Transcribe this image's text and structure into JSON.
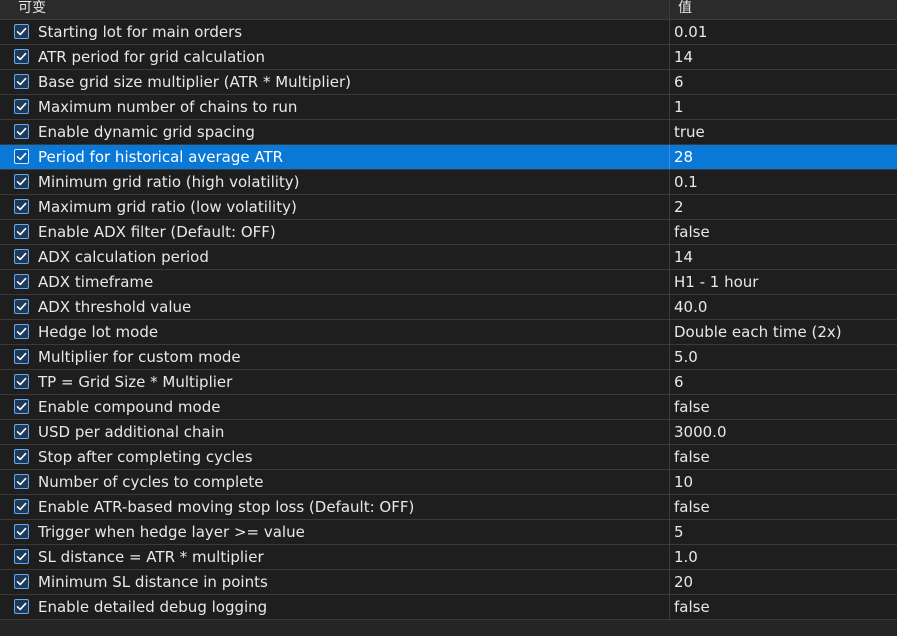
{
  "header": {
    "name_label": "可变",
    "value_label": "值"
  },
  "selected_index": 5,
  "rows": [
    {
      "label": "Starting lot for main orders",
      "value": "0.01",
      "checked": true
    },
    {
      "label": "ATR period for grid calculation",
      "value": "14",
      "checked": true
    },
    {
      "label": "Base grid size multiplier (ATR * Multiplier)",
      "value": "6",
      "checked": true
    },
    {
      "label": "Maximum number of chains to run",
      "value": "1",
      "checked": true
    },
    {
      "label": "Enable dynamic grid spacing",
      "value": "true",
      "checked": true
    },
    {
      "label": "Period for historical average ATR",
      "value": "28",
      "checked": true
    },
    {
      "label": "Minimum grid ratio (high volatility)",
      "value": "0.1",
      "checked": true
    },
    {
      "label": "Maximum grid ratio (low volatility)",
      "value": "2",
      "checked": true
    },
    {
      "label": "Enable ADX filter (Default: OFF)",
      "value": "false",
      "checked": true
    },
    {
      "label": "ADX calculation period",
      "value": "14",
      "checked": true
    },
    {
      "label": "ADX timeframe",
      "value": "H1 - 1 hour",
      "checked": true
    },
    {
      "label": "ADX threshold value",
      "value": "40.0",
      "checked": true
    },
    {
      "label": "Hedge lot mode",
      "value": "Double each time (2x)",
      "checked": true
    },
    {
      "label": "Multiplier for custom mode",
      "value": "5.0",
      "checked": true
    },
    {
      "label": "TP = Grid Size * Multiplier",
      "value": "6",
      "checked": true
    },
    {
      "label": "Enable compound mode",
      "value": "false",
      "checked": true
    },
    {
      "label": "USD per additional chain",
      "value": "3000.0",
      "checked": true
    },
    {
      "label": "Stop after completing cycles",
      "value": "false",
      "checked": true
    },
    {
      "label": "Number of cycles to complete",
      "value": "10",
      "checked": true
    },
    {
      "label": "Enable ATR-based moving stop loss (Default: OFF)",
      "value": "false",
      "checked": true
    },
    {
      "label": "Trigger when hedge layer >= value",
      "value": "5",
      "checked": true
    },
    {
      "label": "SL distance = ATR * multiplier",
      "value": "1.0",
      "checked": true
    },
    {
      "label": "Minimum SL distance in points",
      "value": "20",
      "checked": true
    },
    {
      "label": "Enable detailed debug logging",
      "value": "false",
      "checked": true
    }
  ],
  "icons": {
    "checkbox": "checkbox-checked-icon"
  },
  "colors": {
    "selection": "#0a78d7",
    "checkbox_border": "#6aa8e8"
  }
}
